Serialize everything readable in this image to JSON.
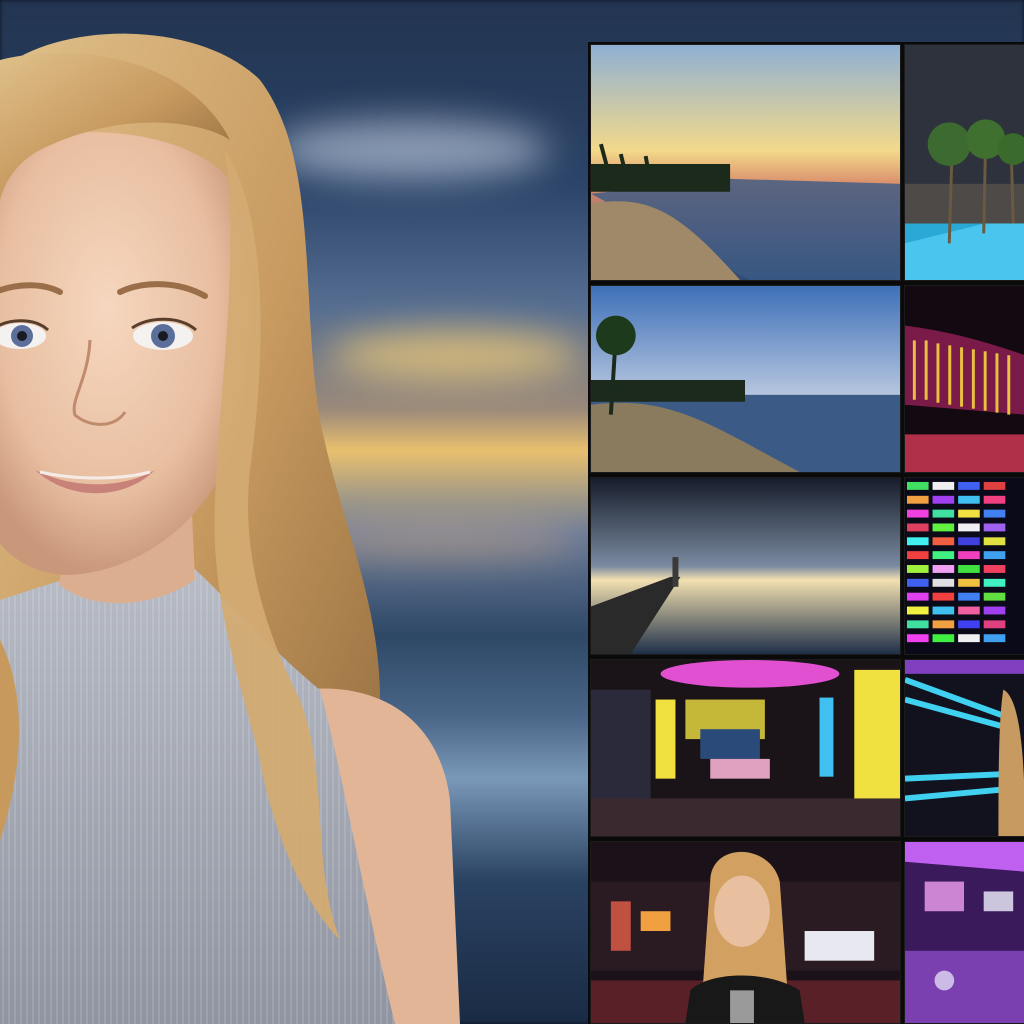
{
  "scene": {
    "subject": "avatar-woman",
    "background": "blurred-sunset-sea",
    "thumbnails": [
      {
        "name": "beach-sunset"
      },
      {
        "name": "resort-pool-palms"
      },
      {
        "name": "beach-palms-dusk"
      },
      {
        "name": "neon-lounge-lights"
      },
      {
        "name": "pier-sunset"
      },
      {
        "name": "led-color-wall"
      },
      {
        "name": "neon-lounge-interior"
      },
      {
        "name": "neon-studio-woman"
      },
      {
        "name": "casino-woman-jacket"
      },
      {
        "name": "neon-blur-lights"
      }
    ]
  },
  "colors": {
    "hair": "#c9a06a",
    "skin": "#eec7aa",
    "sweater": "#a9adb8",
    "sky_dark": "#223450",
    "sunset": "#f0c060"
  }
}
